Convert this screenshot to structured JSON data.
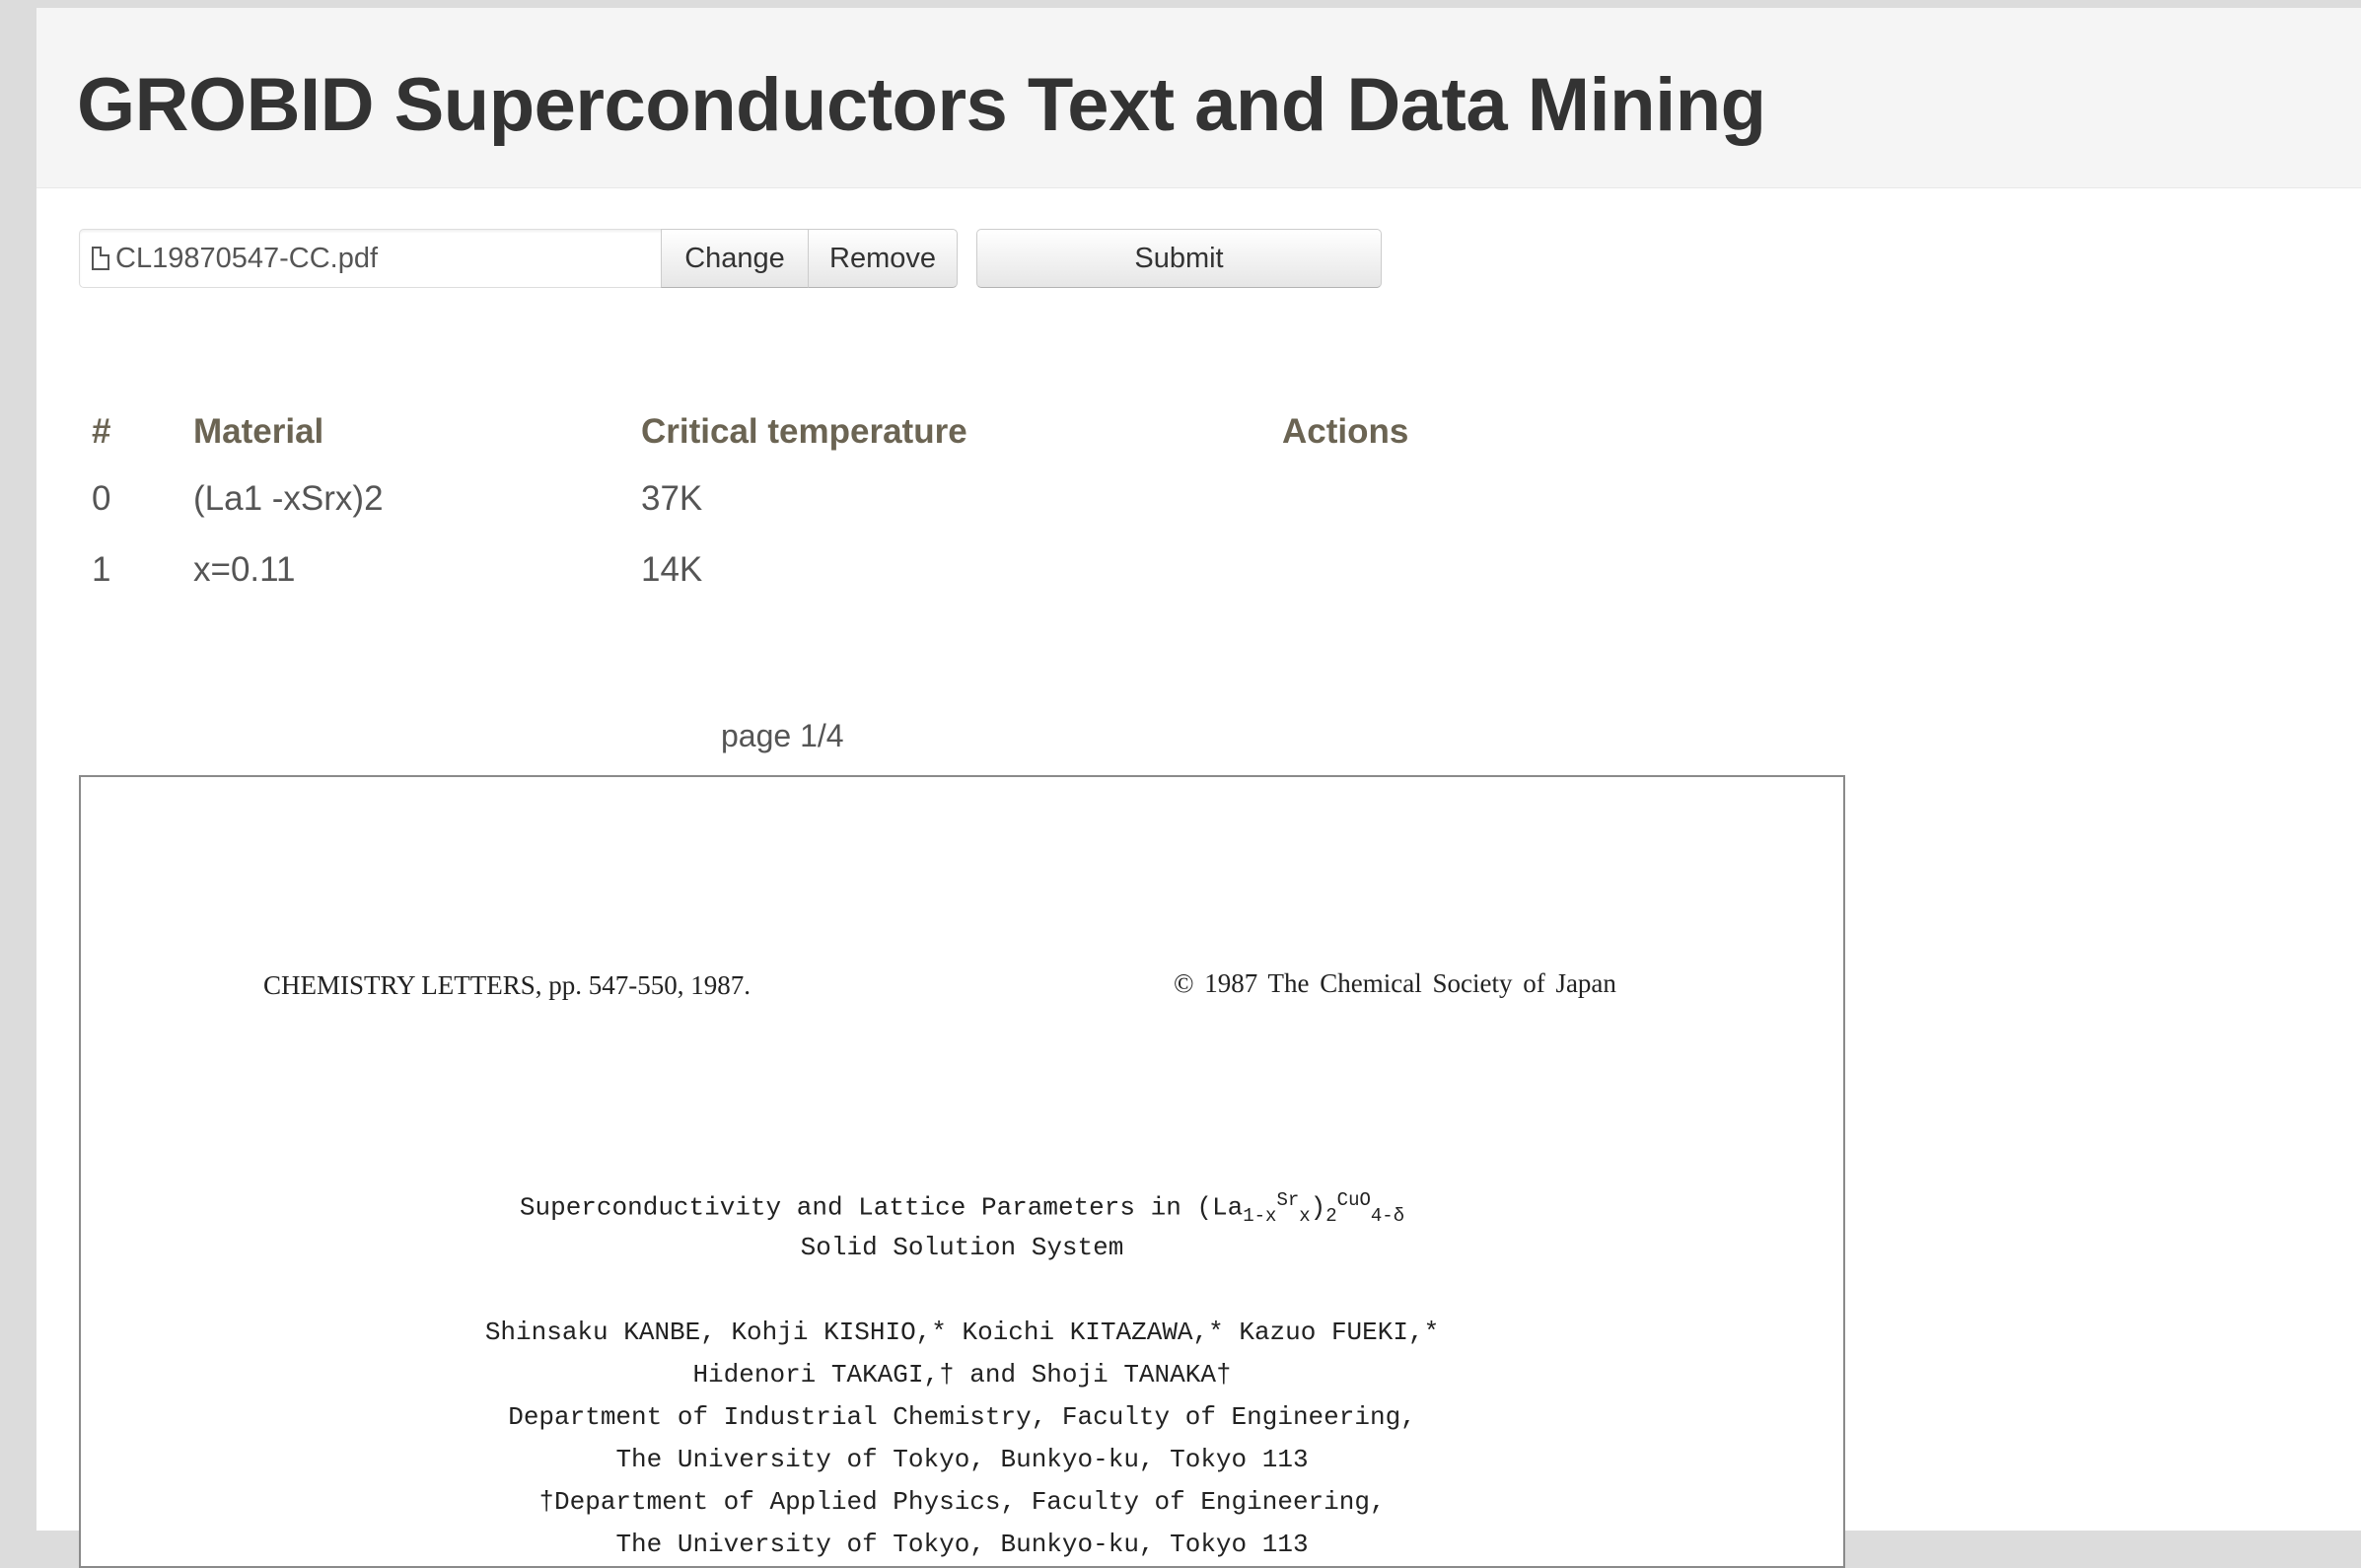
{
  "header": {
    "title": "GROBID Superconductors Text and Data Mining"
  },
  "upload": {
    "filename": "CL19870547-CC.pdf",
    "change_label": "Change",
    "remove_label": "Remove",
    "submit_label": "Submit"
  },
  "table": {
    "headers": [
      "#",
      "Material",
      "Critical temperature",
      "Actions"
    ],
    "rows": [
      {
        "index": "0",
        "material": "(La1 -xSrx)2",
        "tc": "37K"
      },
      {
        "index": "1",
        "material": "x=0.11",
        "tc": "14K"
      }
    ]
  },
  "viewer": {
    "page_label": "page 1/4"
  },
  "pdf": {
    "journal": "CHEMISTRY LETTERS, pp. 547-550, 1987.",
    "copyright": "© 1987  The Chemical Society of Japan",
    "title_line1_a": "Superconductivity and Lattice Parameters in (La",
    "title_sub1": "1-x",
    "title_sr": "Sr",
    "title_sub2": "x",
    "title_paren": ")",
    "title_sub3": "2",
    "title_cuo": "CuO",
    "title_sub4": "4-δ",
    "title_line2": "Solid Solution System",
    "authors1": "Shinsaku KANBE, Kohji KISHIO,* Koichi KITAZAWA,* Kazuo FUEKI,*",
    "authors2": "Hidenori TAKAGI,† and Shoji TANAKA†",
    "affil1": "Department of Industrial Chemistry, Faculty of Engineering,",
    "affil2": "The University of Tokyo, Bunkyo-ku, Tokyo 113",
    "affil3": "†Department of Applied Physics, Faculty of Engineering,",
    "affil4": "The University of Tokyo, Bunkyo-ku, Tokyo 113"
  }
}
